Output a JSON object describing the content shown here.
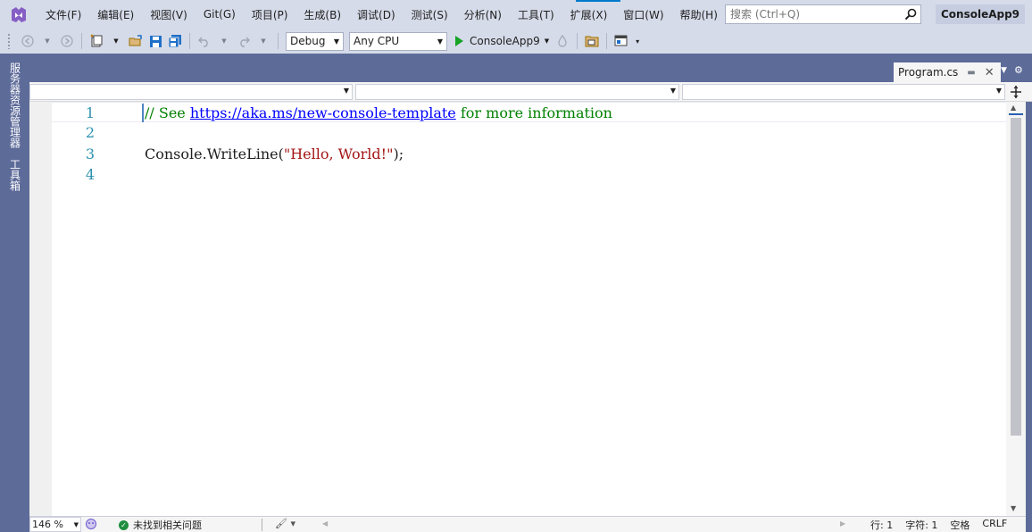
{
  "menubar": {
    "items": [
      "文件(F)",
      "编辑(E)",
      "视图(V)",
      "Git(G)",
      "项目(P)",
      "生成(B)",
      "调试(D)",
      "测试(S)",
      "分析(N)",
      "工具(T)",
      "扩展(X)",
      "窗口(W)",
      "帮助(H)"
    ],
    "search_placeholder": "搜索 (Ctrl+Q)",
    "solution_name": "ConsoleApp9"
  },
  "toolbar": {
    "config": "Debug",
    "platform": "Any CPU",
    "run_target": "ConsoleApp9"
  },
  "sidebar": {
    "tabs": [
      "服务器资源管理器",
      "工具箱"
    ]
  },
  "document": {
    "tab_title": "Program.cs"
  },
  "editor": {
    "lines": [
      {
        "number": "1",
        "tokens": [
          {
            "type": "comment",
            "text": "// See "
          },
          {
            "type": "link",
            "text": "https://aka.ms/new-console-template"
          },
          {
            "type": "comment",
            "text": " for more information"
          }
        ]
      },
      {
        "number": "2",
        "tokens": []
      },
      {
        "number": "3",
        "tokens": [
          {
            "type": "plain",
            "text": "Console.WriteLine("
          },
          {
            "type": "string",
            "text": "\"Hello, World!\""
          },
          {
            "type": "plain",
            "text": ");"
          }
        ]
      },
      {
        "number": "4",
        "tokens": []
      }
    ]
  },
  "statusbar": {
    "zoom": "146 %",
    "health_text": "未找到相关问题",
    "line": "行: 1",
    "char": "字符: 1",
    "whitespace": "空格",
    "line_ending": "CRLF"
  },
  "colors": {
    "accent": "#007acc",
    "chrome_dark": "#5d6b99",
    "comment": "#008000",
    "link": "#0000ff",
    "string": "#a31515",
    "line_number": "#2b91af",
    "run_green": "#16a326"
  }
}
